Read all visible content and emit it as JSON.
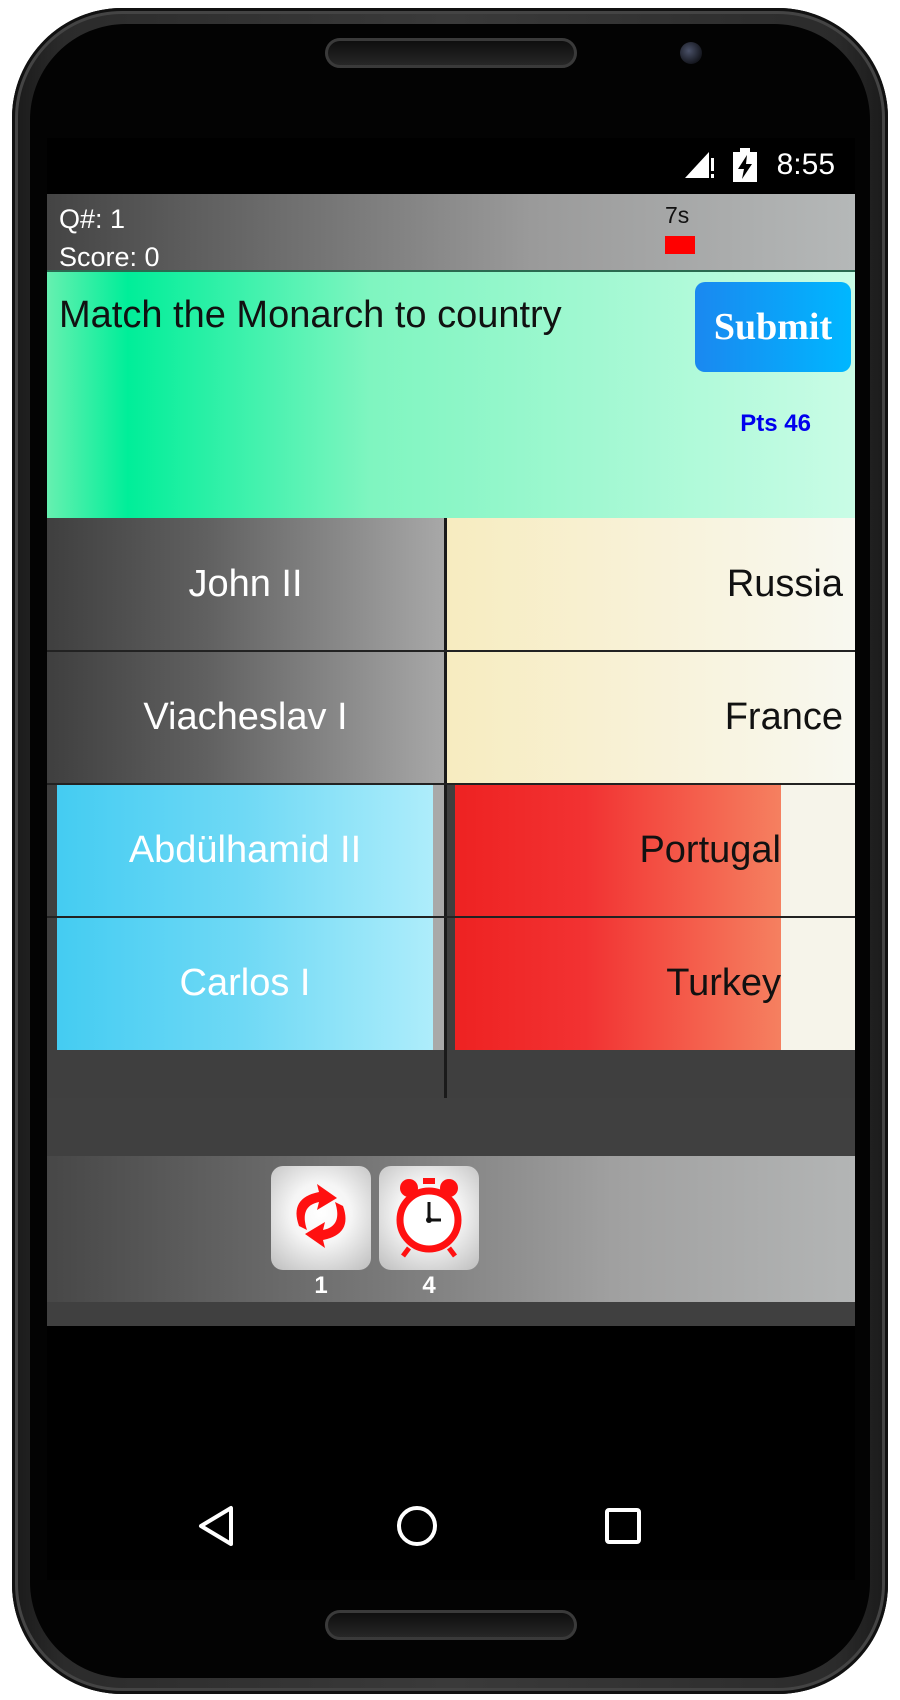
{
  "status_bar": {
    "time": "8:55"
  },
  "header": {
    "question_number": "Q#: 1",
    "score": "Score: 0",
    "timer_text": "7s",
    "timer_fraction": 1.0,
    "timer_color": "#ff0000"
  },
  "question": {
    "text": "Match the Monarch to country",
    "submit_label": "Submit",
    "points": "Pts 46"
  },
  "monarchs": [
    "John II",
    "Viacheslav I",
    "Abdülhamid II",
    "Carlos I"
  ],
  "countries": [
    "Russia",
    "France",
    "Portugal",
    "Turkey"
  ],
  "powerups": [
    {
      "icon": "swap-arrows-icon",
      "count": "1"
    },
    {
      "icon": "alarm-clock-icon",
      "count": "4"
    }
  ],
  "colors": {
    "question_bg": "#00ee99",
    "submit_bg": "#1a88f0",
    "points_text": "#0000ee",
    "selected_left": "#44ccf2",
    "selected_right": "#ee2222"
  }
}
